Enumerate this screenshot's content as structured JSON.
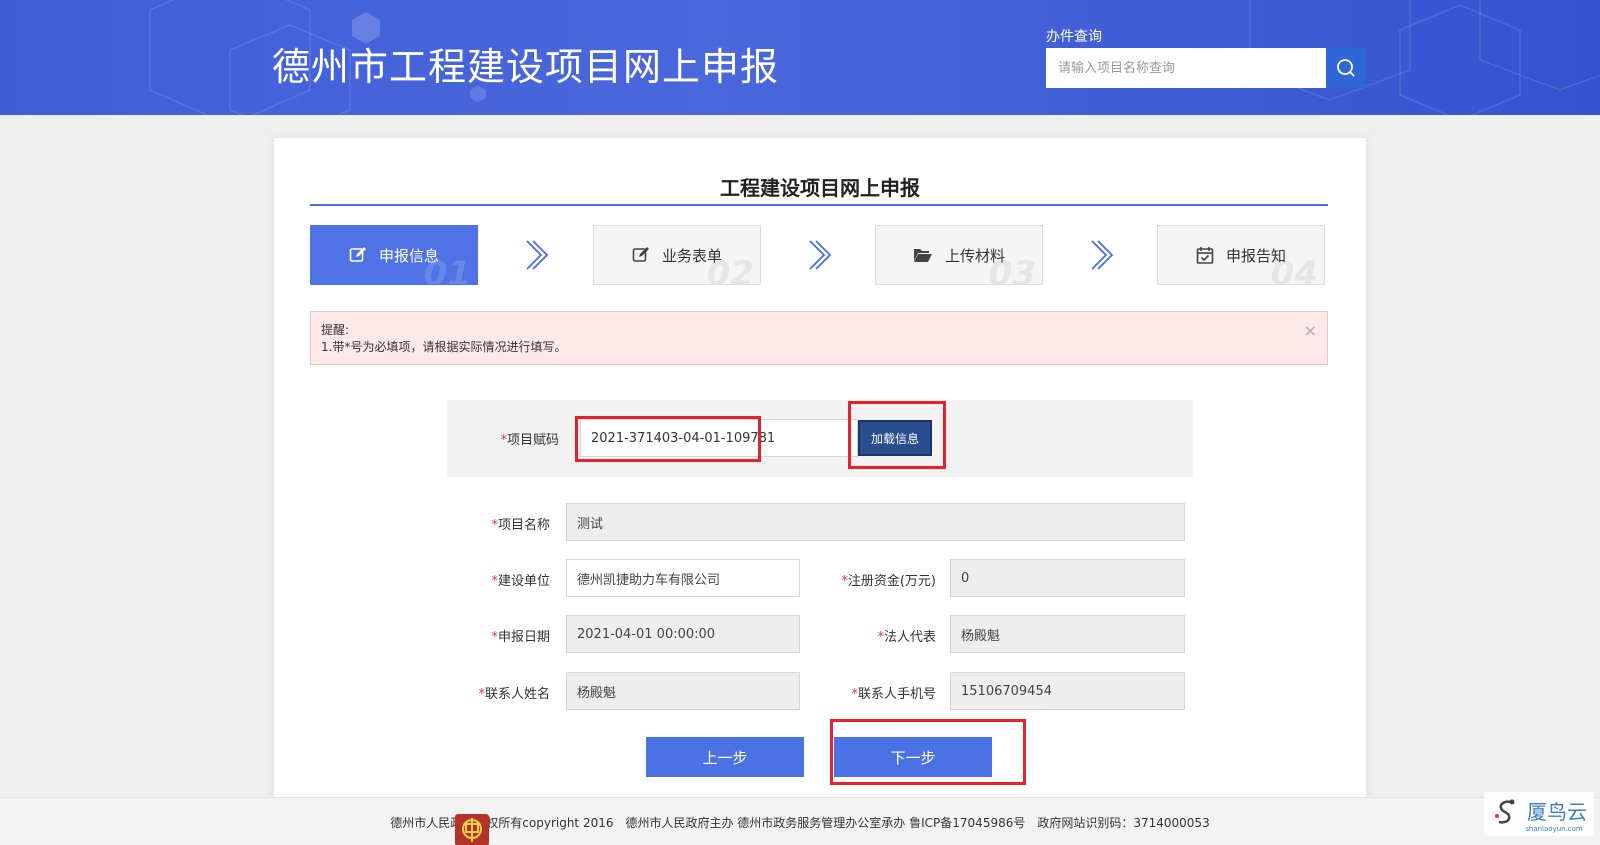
{
  "header": {
    "site_title": "德州市工程建设项目网上申报",
    "search_label": "办件查询",
    "search_placeholder": "请输入项目名称查询"
  },
  "main": {
    "title": "工程建设项目网上申报",
    "steps": [
      {
        "label": "申报信息",
        "num": "01",
        "icon": "edit-icon",
        "active": true
      },
      {
        "label": "业务表单",
        "num": "02",
        "icon": "edit-icon",
        "active": false
      },
      {
        "label": "上传材料",
        "num": "03",
        "icon": "folder-open-icon",
        "active": false
      },
      {
        "label": "申报告知",
        "num": "04",
        "icon": "calendar-check-icon",
        "active": false
      }
    ],
    "alert": {
      "title": "提醒:",
      "message": "1.带*号为必填项，请根据实际情况进行填写。",
      "close": "×"
    },
    "code": {
      "label": "项目赋码",
      "value": "2021-371403-04-01-109781",
      "load_button": "加载信息"
    },
    "fields": {
      "project_name": {
        "label": "项目名称",
        "value": "测试"
      },
      "builder": {
        "label": "建设单位",
        "value": "德州凯捷助力车有限公司"
      },
      "capital": {
        "label": "注册资金(万元)",
        "value": "0"
      },
      "date": {
        "label": "申报日期",
        "value": "2021-04-01 00:00:00"
      },
      "legal_rep": {
        "label": "法人代表",
        "value": "杨殿魁"
      },
      "contact_name": {
        "label": "联系人姓名",
        "value": "杨殿魁"
      },
      "contact_phone": {
        "label": "联系人手机号",
        "value": "15106709454"
      }
    },
    "required_mark": "*",
    "prev_button": "上一步",
    "next_button": "下一步"
  },
  "footer": {
    "text": "德州市人民政府版权所有copyright 2016　德州市人民政府主办 德州市政务服务管理办公室承办 鲁ICP备17045986号　政府网站识别码：3714000053"
  },
  "watermark": {
    "text": "厦鸟云",
    "sub": "shaniaoyun.com"
  },
  "colors": {
    "header_blue": "#4b67dc",
    "active_step": "#4f72e6",
    "button_blue": "#4a72e4",
    "highlight_red": "#e8222a",
    "load_button": "#2a4d8f"
  }
}
